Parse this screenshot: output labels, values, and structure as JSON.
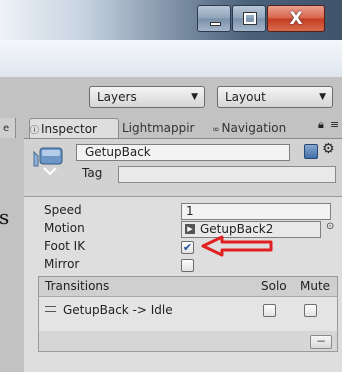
{
  "window": {
    "close_glyph": "X",
    "title_gradient": [
      "#eef2f7",
      "#3f536b"
    ]
  },
  "toolbar": {
    "layers_label": "Layers",
    "layout_label": "Layout"
  },
  "edge_slivers": [
    "e",
    "s"
  ],
  "tabs": [
    {
      "label": "Inspector",
      "icon": "info-icon"
    },
    {
      "label": "Lightmappir",
      "icon": ""
    },
    {
      "label": "Navigation",
      "icon": "navmesh-icon"
    }
  ],
  "header": {
    "name": "GetupBack",
    "tag_label": "Tag"
  },
  "properties": {
    "speed_label": "Speed",
    "speed_value": "1",
    "motion_label": "Motion",
    "motion_value": "GetupBack2",
    "footik_label": "Foot IK",
    "footik_checked": true,
    "mirror_label": "Mirror",
    "mirror_checked": false
  },
  "transitions": {
    "title": "Transitions",
    "solo_label": "Solo",
    "mute_label": "Mute",
    "items": [
      {
        "name": "GetupBack -> Idle",
        "solo": false,
        "mute": false
      }
    ],
    "remove_label": "−"
  },
  "colors": {
    "panel_bg": "#dedede",
    "editor_bg": "#c2c2c2",
    "annotation_red": "#e02020",
    "close_button": "#c43c22"
  }
}
